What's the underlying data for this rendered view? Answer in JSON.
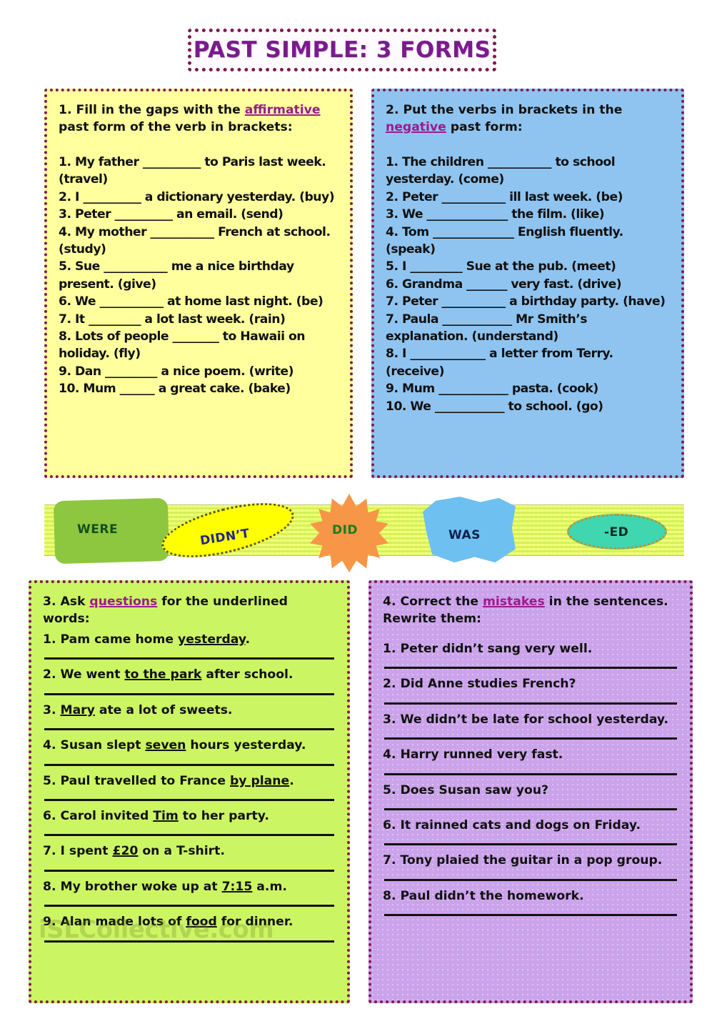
{
  "page": {
    "title": "PAST SIMPLE: 3 FORMS",
    "watermark": "iSLCollective.com",
    "background": "#ffffff",
    "border_color": "#7d1a4f",
    "title_color": "#7a1b8c",
    "highlight_color": "#9b1b8e"
  },
  "exercise1": {
    "box_color": "#ffff9e",
    "instruction_prefix": "1. Fill in the gaps with the ",
    "instruction_highlight": "affirmative",
    "instruction_suffix": " past form of the verb in brackets:",
    "items": [
      "1. My father __________ to Paris last week. (travel)",
      "2. I __________ a dictionary yesterday. (buy)",
      "3. Peter __________ an email. (send)",
      "4. My mother ___________ French at school. (study)",
      "5. Sue ___________ me a nice birthday present. (give)",
      "6. We ___________ at home last night. (be)",
      "7. It _________ a lot last week. (rain)",
      "8. Lots of people ________ to Hawaii on holiday. (fly)",
      "9. Dan _________ a nice poem. (write)",
      "10. Mum ______ a great cake. (bake)"
    ]
  },
  "exercise2": {
    "box_color": "#8fc4f0",
    "instruction_prefix": "2. Put the verbs in brackets in the ",
    "instruction_highlight": "negative",
    "instruction_suffix": " past form:",
    "items": [
      "1. The children ___________ to school yesterday. (come)",
      "2. Peter ___________ ill last week. (be)",
      "3. We ______________ the film. (like)",
      "4. Tom ______________ English fluently. (speak)",
      "5. I _________ Sue at the pub. (meet)",
      "6. Grandma _______ very fast. (drive)",
      "7. Peter ___________ a birthday party. (have)",
      "7. Paula ____________ Mr Smith’s explanation. (understand)",
      "8. I _____________ a letter from Terry. (receive)",
      "9. Mum ____________ pasta. (cook)",
      "10. We ____________ to school. (go)"
    ]
  },
  "banner": {
    "background_color": "#eaff7a",
    "chips": [
      {
        "label": "WERE",
        "shape": "rounded-rectangle",
        "fill": "#8dc63f",
        "text_color": "#14501e"
      },
      {
        "label": "DIDN’T",
        "shape": "ellipse-rotated",
        "fill": "#ffff00",
        "text_color": "#24248c"
      },
      {
        "label": "DID",
        "shape": "starburst",
        "fill": "#f79646",
        "text_color": "#1f7a1f"
      },
      {
        "label": "WAS",
        "shape": "wavy-flag",
        "fill": "#6dc0f0",
        "text_color": "#0d1f4d"
      },
      {
        "label": "-ED",
        "shape": "ellipse",
        "fill": "#3fd6b0",
        "text_color": "#0d2b22"
      }
    ]
  },
  "exercise3": {
    "box_color": "#ccf564",
    "instruction_prefix": "3. Ask ",
    "instruction_highlight": "questions",
    "instruction_suffix": " for the underlined words:",
    "items": [
      {
        "num": "1. ",
        "pre": "Pam came home ",
        "underlined": "yesterday",
        "post": "."
      },
      {
        "num": "2. ",
        "pre": "We went ",
        "underlined": "to the park",
        "post": " after school."
      },
      {
        "num": "3. ",
        "pre": "",
        "underlined": "Mary",
        "post": " ate a lot of sweets."
      },
      {
        "num": "4. ",
        "pre": "Susan slept ",
        "underlined": "seven",
        "post": " hours yesterday."
      },
      {
        "num": "5. ",
        "pre": "Paul travelled to France ",
        "underlined": "by plane",
        "post": "."
      },
      {
        "num": "6. ",
        "pre": "Carol invited ",
        "underlined": "Tim",
        "post": " to her party."
      },
      {
        "num": "7. ",
        "pre": "I spent ",
        "underlined": "£20",
        "post": " on a T-shirt."
      },
      {
        "num": "8. ",
        "pre": "My brother woke up at ",
        "underlined": "7:15",
        "post": " a.m."
      },
      {
        "num": "9. ",
        "pre": "Alan made lots of ",
        "underlined": "food",
        "post": " for dinner."
      }
    ]
  },
  "exercise4": {
    "box_color": "#cba3ea",
    "instruction_prefix": "4. Correct the ",
    "instruction_highlight": "mistakes",
    "instruction_suffix": " in the sentences. Rewrite them:",
    "items": [
      "1. Peter didn’t sang very well.",
      "2. Did Anne studies French?",
      "3. We didn’t be late for school yesterday.",
      "4. Harry runned very fast.",
      "5. Does Susan saw you?",
      "6. It rainned cats and dogs on Friday.",
      "7. Tony plaied the guitar in a pop group.",
      "8. Paul didn’t the homework."
    ]
  }
}
